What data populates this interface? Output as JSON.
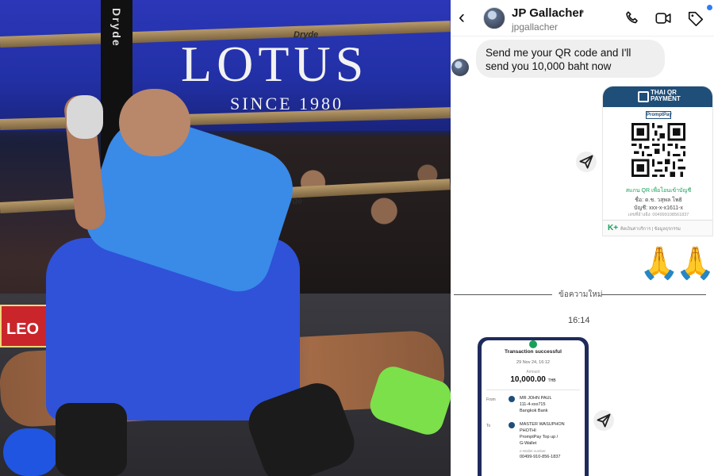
{
  "photo": {
    "banner_title": "LOTUS",
    "banner_sub": "SINCE 1980",
    "rope_brand": "Dryde",
    "post_brand": "Dryde",
    "sponsor": "LEO"
  },
  "header": {
    "name": "JP Gallacher",
    "handle": "jpgallacher"
  },
  "messages": {
    "incoming_text": "Send me your QR code and I'll send you 10,000 baht now",
    "pray_emoji": "🙏🙏",
    "divider_label": "ข้อความใหม่",
    "time": "16:14"
  },
  "qr_card": {
    "header_text": "THAI QR PAYMENT",
    "promptpay": "PromptPay",
    "line1": "สแกน QR เพื่อโอนเข้าบัญชี",
    "line2": "ชื่อ: ด.ช. วสุพล โพธิ",
    "line3": "บัญชี: xxx-x-x1611-x",
    "line4": "เลขที่อ้างอิง: 004999108561837",
    "footer_k": "K+",
    "footer_text": "คิดเงินค่าบริการ | ข้อมูลธุรกรรม"
  },
  "receipt": {
    "title": "Transaction successful",
    "date": "29 Nov 24, 16:12",
    "amount_label": "Amount",
    "amount": "10,000.00",
    "currency": "THB",
    "from_label": "From",
    "from_name": "MR JOHN PAUL",
    "from_acct": "111-4-xxx715",
    "from_bank": "Bangkok Bank",
    "to_label": "To",
    "to_name": "MASTER WASUPHON",
    "to_name2": "PHOTHI",
    "to_service": "PromptPay Top up /",
    "to_service2": "G-Wallet",
    "to_small": "e-Wallet number",
    "to_number": "00499-910-856-1837"
  },
  "colors": {
    "accent": "#2f7cf6",
    "qr_header": "#1f4e79",
    "success": "#19a05a",
    "bubble": "#efefef"
  }
}
